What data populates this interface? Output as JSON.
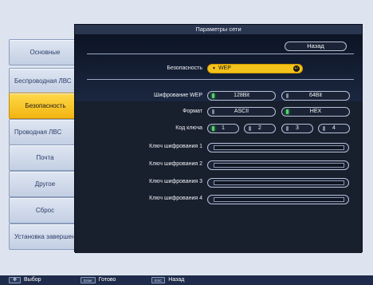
{
  "menu": {
    "items": [
      {
        "label": "Основные",
        "active": false
      },
      {
        "label": "Беспроводная ЛВС",
        "active": false
      },
      {
        "label": "Безопасность",
        "active": true
      },
      {
        "label": "Проводная ЛВС",
        "active": false
      },
      {
        "label": "Почта",
        "active": false
      },
      {
        "label": "Другое",
        "active": false
      },
      {
        "label": "Сброс",
        "active": false
      },
      {
        "label": "Установка завершена",
        "active": false
      }
    ]
  },
  "panel": {
    "title": "Параметры сети",
    "back_button": "Назад",
    "security": {
      "label": "Безопасность",
      "value": "WEP",
      "arrow_icon": "triangle-down-icon",
      "enter_icon": "enter-icon"
    },
    "wep_encryption": {
      "label": "Шифрование WEP",
      "options": [
        {
          "label": "128Bit",
          "selected": true
        },
        {
          "label": "64Bit",
          "selected": false
        }
      ]
    },
    "format": {
      "label": "Формат",
      "options": [
        {
          "label": "ASCII",
          "selected": false
        },
        {
          "label": "HEX",
          "selected": true
        }
      ]
    },
    "key_id": {
      "label": "Код ключа",
      "options": [
        {
          "label": "1",
          "selected": true
        },
        {
          "label": "2",
          "selected": false
        },
        {
          "label": "3",
          "selected": false
        },
        {
          "label": "4",
          "selected": false
        }
      ]
    },
    "keys": [
      {
        "label": "Ключ шифрования 1",
        "value": ""
      },
      {
        "label": "Ключ шифрования 2",
        "value": ""
      },
      {
        "label": "Ключ шифрования 3",
        "value": ""
      },
      {
        "label": "Ключ шифрования 4",
        "value": ""
      }
    ]
  },
  "bottom_bar": {
    "select": {
      "key": "✥",
      "label": "Выбор"
    },
    "done": {
      "key": "Enter",
      "label": "Готово"
    },
    "back": {
      "key": "ESC",
      "label": "Назад"
    }
  },
  "colors": {
    "accent": "#f3c21b",
    "selected_dot": "#4cd964",
    "panel_bg": "#101828",
    "page_bg": "#dde4ef"
  }
}
